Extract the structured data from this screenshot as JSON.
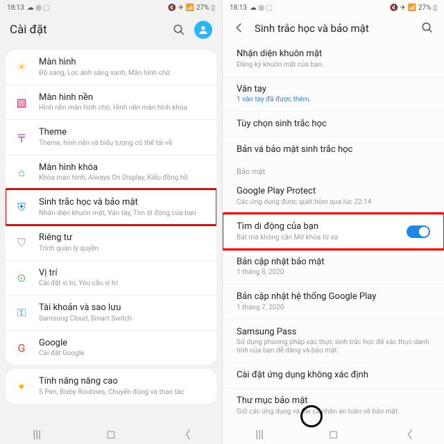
{
  "status": {
    "time": "18:13",
    "battery": "27%"
  },
  "left": {
    "title": "Cài đặt",
    "groups": [
      [
        {
          "icon": "☀",
          "iconColor": "#f5c542",
          "name": "display",
          "label": "Màn hình",
          "sub": "Độ sáng, Lọc ánh sáng xanh, Màn hình chờ"
        },
        {
          "icon": "▧",
          "iconColor": "#e91e63",
          "name": "wallpaper",
          "label": "Màn hình nền",
          "sub": "Hình nền màn hình chờ, Hình nền màn hình khóa"
        },
        {
          "icon": "〒",
          "iconColor": "#ab47bc",
          "name": "theme",
          "label": "Theme",
          "sub": "Theme, hình nền và biểu tượng có thể tải về"
        },
        {
          "icon": "⌂",
          "iconColor": "#26a69a",
          "name": "lockscreen",
          "label": "Màn hình khóa",
          "sub": "Khóa màn hình, Always On Display, Kiểu đồng hồ"
        },
        {
          "icon": "⛨",
          "iconColor": "#1e88e5",
          "name": "biometrics",
          "label": "Sinh trắc học và bảo mật",
          "sub": "Nhận diện khuôn mặt, Vân tay, Tìm di động của bạn",
          "highlight": true
        },
        {
          "icon": "⛉",
          "iconColor": "#90a4ae",
          "name": "privacy",
          "label": "Riêng tư",
          "sub": "Trình quản lý quyền"
        },
        {
          "icon": "⊙",
          "iconColor": "#66bb6a",
          "name": "location",
          "label": "Vị trí",
          "sub": "Cài đặt vị trí, Yêu cầu vị trí"
        },
        {
          "icon": "⚿",
          "iconColor": "#1e88e5",
          "name": "accounts",
          "label": "Tài khoản và sao lưu",
          "sub": "Samsung Cloud, Smart Switch"
        },
        {
          "icon": "G",
          "iconColor": "#ea4335",
          "name": "google",
          "label": "Google",
          "sub": "Cài đặt Google"
        }
      ],
      [
        {
          "icon": "✦",
          "iconColor": "#ffb300",
          "name": "advanced",
          "label": "Tính năng nâng cao",
          "sub": "S Pen, Bixby Routines, Chuyển động và thao tác"
        }
      ]
    ]
  },
  "right": {
    "title": "Sinh trắc học và bảo mật",
    "items": [
      {
        "name": "face",
        "label": "Nhận diện khuôn mặt",
        "sub": "Đăng ký khuôn mặt của bạn."
      },
      {
        "name": "fingerprint",
        "label": "Vân tay",
        "sub": "1 vân tay đã được thêm.",
        "subLink": true
      },
      {
        "name": "bio-pref",
        "label": "Tùy chọn sinh trắc học"
      },
      {
        "name": "bio-patch",
        "label": "Bản vá bảo mật sinh trắc học"
      }
    ],
    "sectionHead": "Bảo mật",
    "items2": [
      {
        "name": "play-protect",
        "label": "Google Play Protect",
        "sub": "Các ứng dụng được quét hôm qua lúc 22:14"
      },
      {
        "name": "find-mobile",
        "label": "Tìm di động của bạn",
        "sub": "Bật mà không cần Mở khóa từ xa",
        "toggle": true,
        "highlight": true
      },
      {
        "name": "sec-update",
        "label": "Bản cập nhật bảo mật",
        "sub": "1 tháng 8, 2020"
      },
      {
        "name": "play-update",
        "label": "Bản cập nhật hệ thống Google Play",
        "sub": "1 tháng 7, 2020"
      },
      {
        "name": "samsung-pass",
        "label": "Samsung Pass",
        "sub": "Sử dụng phương pháp xác thực sinh trắc học để xác thực danh tính của bạn dễ dàng và bảo mật."
      },
      {
        "name": "unknown-apps",
        "label": "Cài đặt ứng dụng không xác định"
      },
      {
        "name": "secure-folder",
        "label": "Thư mục bảo mật",
        "sub": "Giữ các ứng dụng và file cá nhân an toàn và bảo mật."
      }
    ]
  }
}
